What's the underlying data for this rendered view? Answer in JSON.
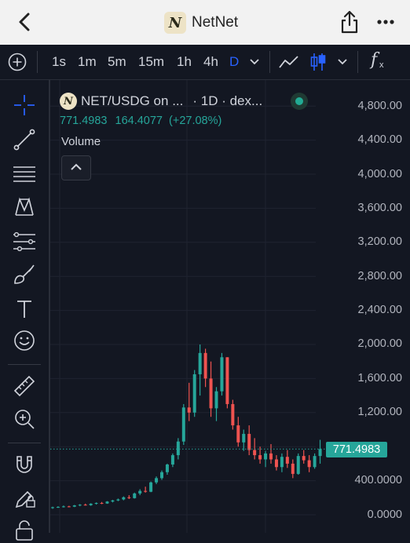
{
  "app": {
    "name": "NetNet",
    "logo_glyph": "N"
  },
  "toolbar": {
    "intervals": [
      "1s",
      "1m",
      "5m",
      "15m",
      "1h",
      "4h",
      "D"
    ],
    "active_interval": "D",
    "fx_label": "f",
    "fx_sub": "x"
  },
  "legend": {
    "symbol": "NET/USDG on ...",
    "interval_source": "· 1D · dex...",
    "last": "771.4983",
    "change": "164.4077",
    "change_pct": "(+27.08%)",
    "volume_label": "Volume"
  },
  "price_axis": {
    "labels": [
      "4,800.00",
      "4,400.00",
      "4,000.00",
      "3,600.00",
      "3,200.00",
      "2,800.00",
      "2,400.00",
      "2,000.00",
      "1,600.00",
      "1,200.00",
      "400.0000",
      "0.0000"
    ],
    "last_price_tag": "771.4983"
  },
  "colors": {
    "up": "#26a69a",
    "down": "#ef5350",
    "accent": "#2962ff",
    "background": "#131722"
  },
  "icons": [
    "back-icon",
    "share-icon",
    "more-icon",
    "add-indicator-icon",
    "line-chart-icon",
    "candles-icon",
    "chevron-down-icon",
    "crosshair-icon",
    "trendline-icon",
    "fib-icon",
    "pattern-icon",
    "projection-icon",
    "brush-icon",
    "text-icon",
    "emoji-icon",
    "ruler-icon",
    "zoom-icon",
    "magnet-icon",
    "lock-drawings-icon",
    "lock-icon",
    "live-dot-icon",
    "collapse-chevron-icon"
  ]
}
